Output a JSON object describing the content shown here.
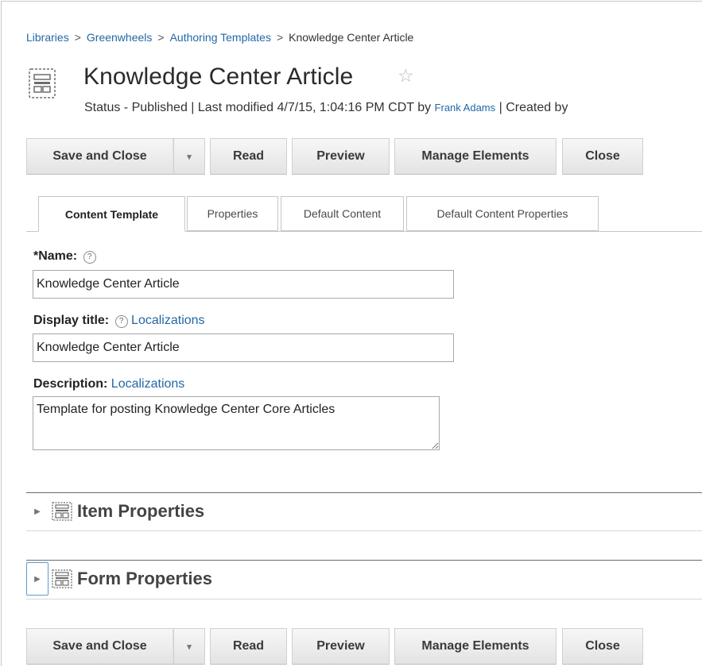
{
  "breadcrumb": {
    "items": [
      "Libraries",
      "Greenwheels",
      "Authoring Templates"
    ],
    "current": "Knowledge Center Article",
    "separator": ">"
  },
  "header": {
    "title": "Knowledge Center Article",
    "status_prefix": "Status - Published | Last modified 4/7/15, 1:04:16 PM CDT by ",
    "modified_by": "Frank Adams",
    "status_suffix": " | Created by"
  },
  "toolbar": {
    "save_close": "Save and Close",
    "dropdown_glyph": "▾",
    "read": "Read",
    "preview": "Preview",
    "manage_elements": "Manage Elements",
    "close": "Close"
  },
  "tabs": [
    {
      "label": "Content Template",
      "active": true
    },
    {
      "label": "Properties",
      "active": false
    },
    {
      "label": "Default Content",
      "active": false
    },
    {
      "label": "Default Content Properties",
      "active": false
    }
  ],
  "form": {
    "name_label": "*Name:",
    "name_value": "Knowledge Center Article",
    "display_title_label": "Display title:",
    "display_title_value": "Knowledge Center Article",
    "description_label": "Description:",
    "description_value": "Template for posting Knowledge Center Core Articles",
    "localizations_link": "Localizations",
    "help_glyph": "?"
  },
  "sections": [
    {
      "title": "Item Properties",
      "expanded": false
    },
    {
      "title": "Form Properties",
      "expanded": false
    }
  ],
  "colors": {
    "link": "#2368a6",
    "button_top": "#f7f7f7",
    "button_bottom": "#e3e3e3",
    "focus_ring": "#5b9bd5"
  },
  "icons": {
    "template": "template-icon",
    "favorite": "star-outline-icon",
    "expand": "caret-right-icon",
    "section": "form-layout-icon"
  }
}
